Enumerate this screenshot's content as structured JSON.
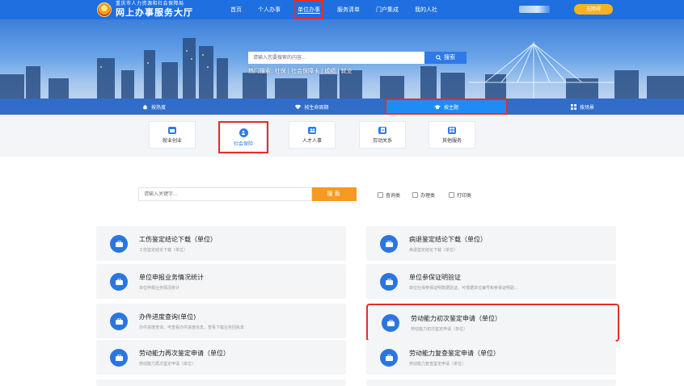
{
  "header": {
    "logo_small": "重庆市人力资源和社会保障局",
    "logo_big": "网上办事服务大厅",
    "nav": [
      {
        "label": "首页",
        "active": false
      },
      {
        "label": "个人办事",
        "active": false
      },
      {
        "label": "单位办事",
        "active": true
      },
      {
        "label": "服务清单",
        "active": false
      },
      {
        "label": "门户集成",
        "active": false
      },
      {
        "label": "我的人社",
        "active": false
      }
    ],
    "login_label": "无障碍"
  },
  "banner": {
    "search_placeholder": "请输入您要搜索的内容...",
    "search_button": "搜索",
    "hot_label": "热门搜索:",
    "hot_terms": [
      "社保",
      "社会保障卡",
      "成绩",
      "就业"
    ],
    "tabs": [
      {
        "label": "按热度",
        "icon": "home-icon",
        "active": false
      },
      {
        "label": "按生命周期",
        "icon": "heart-icon",
        "active": false
      },
      {
        "label": "按主题",
        "icon": "graduation-cap-icon",
        "active": true
      },
      {
        "label": "按场景",
        "icon": "grid-icon",
        "active": false
      }
    ]
  },
  "categories": [
    {
      "label": "就业创业",
      "icon": "briefcase-icon",
      "active": false
    },
    {
      "label": "社会保险",
      "icon": "shield-person-icon",
      "active": true
    },
    {
      "label": "人才人事",
      "icon": "people-icon",
      "active": false
    },
    {
      "label": "劳动关系",
      "icon": "document-icon",
      "active": false
    },
    {
      "label": "其他服务",
      "icon": "grid-icon",
      "active": false
    }
  ],
  "filter": {
    "keyword_placeholder": "请输入关键字...",
    "search_button": "搜索",
    "checkboxes": [
      "查询类",
      "办理类",
      "打印类"
    ]
  },
  "services": [
    {
      "title": "工伤鉴定结论下载（单位）",
      "sub": "工伤鉴定结论下载（单位）",
      "highlight": false
    },
    {
      "title": "病退鉴定结论下载（单位）",
      "sub": "病退鉴定结论下载（单位）",
      "highlight": false
    },
    {
      "title": "单位申报业务情况统计",
      "sub": "单位申报业务情况统计",
      "highlight": false
    },
    {
      "title": "单位参保证明验证",
      "sub": "单位社保参保证明数据验证，可根据单位编号和参保证明验...",
      "highlight": false
    },
    {
      "title": "办件进度查询(单位)",
      "sub": "办件进度查询，可查看办件进度信息，查看下载业务回执单",
      "highlight": false
    },
    {
      "title": "劳动能力初次鉴定申请（单位）",
      "sub": "劳动能力初次鉴定申请（单位）",
      "highlight": true
    },
    {
      "title": "劳动能力再次鉴定申请（单位）",
      "sub": "劳动能力再次鉴定申请（单位）",
      "highlight": false
    },
    {
      "title": "劳动能力复查鉴定申请（单位）",
      "sub": "劳动能力复查鉴定申请（单位）",
      "highlight": false
    }
  ],
  "colors": {
    "primary": "#1f6fe0",
    "accent_orange": "#f59a23",
    "highlight_red": "#e0302a",
    "login_yellow": "#f6b31f"
  }
}
